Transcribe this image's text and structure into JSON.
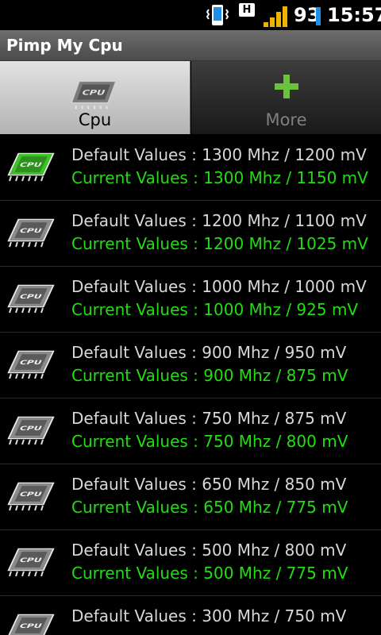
{
  "status_bar": {
    "network_type": "H",
    "battery_percent": "93",
    "time": "15:57",
    "icons": [
      "phone-vibrate-icon",
      "hsdpa-icon",
      "signal-strength-icon",
      "battery-icon"
    ],
    "battery_color": "#1e8fe8",
    "signal_color": "#f0b400"
  },
  "app": {
    "title": "Pimp My Cpu"
  },
  "tabs": [
    {
      "label": "Cpu",
      "icon": "cpu-chip-icon",
      "selected": true
    },
    {
      "label": "More",
      "icon": "plus-icon",
      "selected": false
    }
  ],
  "colors": {
    "default_text": "#d8d8d8",
    "current_text": "#22dd11",
    "plus_icon": "#6cc23a",
    "active_chip": "#3ec22a",
    "inactive_chip": "#8a8a8a"
  },
  "frequencies": [
    {
      "default": "Default Values : 1300 Mhz / 1200 mV",
      "current": "Current Values : 1300 Mhz / 1150 mV",
      "active": true,
      "icon": "cpu-chip-active-icon"
    },
    {
      "default": "Default Values : 1200 Mhz / 1100 mV",
      "current": "Current Values : 1200 Mhz / 1025 mV",
      "active": false,
      "icon": "cpu-chip-icon"
    },
    {
      "default": "Default Values : 1000 Mhz / 1000 mV",
      "current": "Current Values : 1000 Mhz / 925 mV",
      "active": false,
      "icon": "cpu-chip-icon"
    },
    {
      "default": "Default Values : 900 Mhz / 950 mV",
      "current": "Current Values : 900 Mhz / 875 mV",
      "active": false,
      "icon": "cpu-chip-icon"
    },
    {
      "default": "Default Values : 750 Mhz / 875 mV",
      "current": "Current Values : 750 Mhz / 800 mV",
      "active": false,
      "icon": "cpu-chip-icon"
    },
    {
      "default": "Default Values : 650 Mhz / 850 mV",
      "current": "Current Values : 650 Mhz / 775 mV",
      "active": false,
      "icon": "cpu-chip-icon"
    },
    {
      "default": "Default Values : 500 Mhz / 800 mV",
      "current": "Current Values : 500 Mhz / 775 mV",
      "active": false,
      "icon": "cpu-chip-icon"
    },
    {
      "default": "Default Values : 300 Mhz / 750 mV",
      "current": "",
      "active": false,
      "icon": "cpu-chip-icon"
    }
  ]
}
